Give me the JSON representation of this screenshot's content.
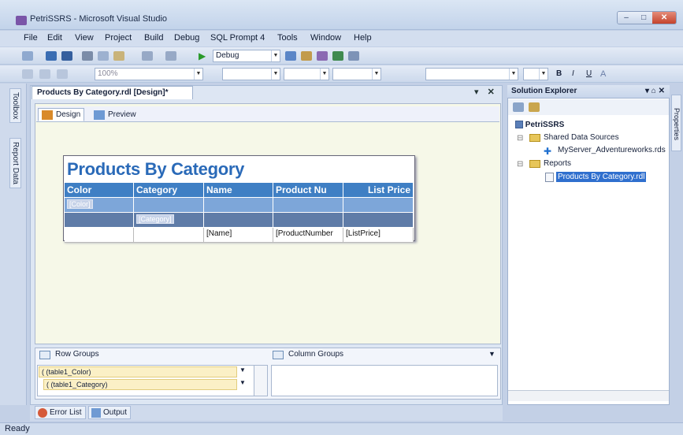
{
  "window": {
    "title": "PetriSSRS - Microsoft Visual Studio",
    "minimize": "–",
    "maximize": "□",
    "close": "✕"
  },
  "menu": [
    "File",
    "Edit",
    "View",
    "Project",
    "Build",
    "Debug",
    "SQL Prompt 4",
    "Tools",
    "Window",
    "Help"
  ],
  "toolbar1": {
    "config": "Debug"
  },
  "toolbar2": {
    "zoom": "100%"
  },
  "toolbox": {
    "tabs": [
      "Toolbox",
      "Report Data"
    ]
  },
  "document": {
    "tab_title": "Products By Category.rdl [Design]*",
    "view_tabs": [
      "Design",
      "Preview"
    ],
    "report": {
      "title": "Products By Category",
      "columns": [
        "Color",
        "Category",
        "Name",
        "Product Nu",
        "List Price"
      ],
      "group1_row": [
        "[Color]",
        "",
        "",
        "",
        ""
      ],
      "group2_row": [
        "",
        "[Category]",
        "",
        "",
        ""
      ],
      "detail_row": [
        "",
        "",
        "[Name]",
        "[ProductNumber",
        "[ListPrice]"
      ]
    },
    "row_groups_label": "Row Groups",
    "column_groups_label": "Column Groups",
    "row_groups": [
      "( (table1_Color)",
      "( (table1_Category)"
    ]
  },
  "solution_explorer": {
    "title": "Solution Explorer",
    "pin": "▾ ⌂ ✕",
    "project": "PetriSSRS",
    "shared_sources": "Shared Data Sources",
    "datasource": "MyServer_Adventureworks.rds",
    "reports_folder": "Reports",
    "report_file": "Products By Category.rdl"
  },
  "properties_tab": "Properties",
  "bottom_tabs": [
    "Error List",
    "Output"
  ],
  "status": "Ready"
}
